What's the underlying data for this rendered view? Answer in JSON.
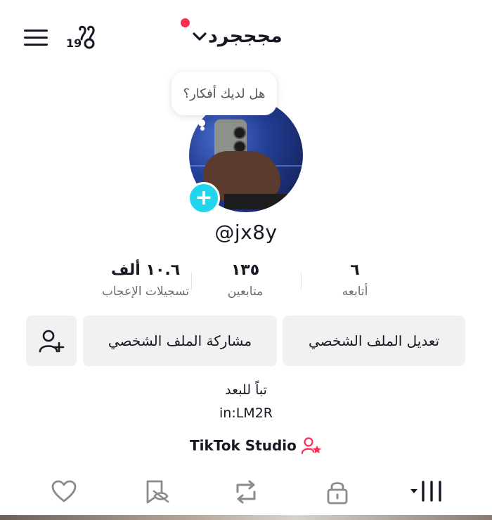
{
  "header": {
    "username": "مجججرد",
    "views_badge": "19"
  },
  "profile": {
    "note_bubble": "هل لديك أفكار؟",
    "handle": "@jx8y"
  },
  "stats": [
    {
      "value": "١٠.٦ ألف",
      "label": "تسجيلات الإعجاب"
    },
    {
      "value": "١٣٥",
      "label": "متابعين"
    },
    {
      "value": "٦",
      "label": "أتابعه"
    }
  ],
  "buttons": {
    "edit_profile": "تعديل الملف الشخصي",
    "share_profile": "مشاركة الملف الشخصي"
  },
  "bio": {
    "line1": "تباً للبعد",
    "line2": "in:LM2R"
  },
  "studio": {
    "label": "TikTok Studio"
  },
  "tabs": [
    "videos",
    "private",
    "reposts",
    "favorites",
    "liked"
  ],
  "colors": {
    "accent": "#fe2c55",
    "avatar_add": "#20d5ec"
  }
}
